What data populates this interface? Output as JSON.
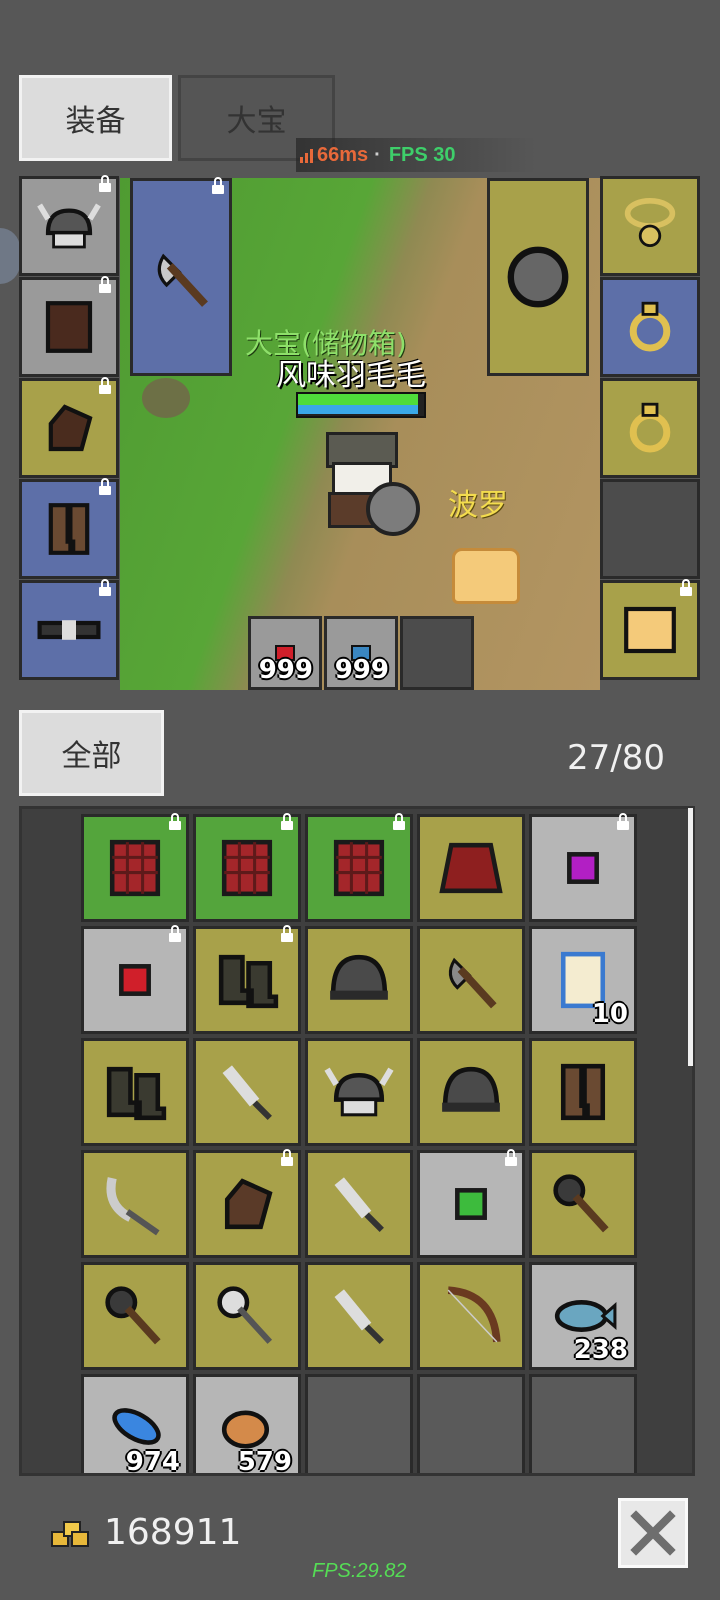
{
  "tabs": {
    "equipment": "装备",
    "character": "大宝"
  },
  "net": {
    "ping": "66ms",
    "separator": "·",
    "fps": "FPS 30"
  },
  "scene": {
    "storage_label": "大宝(储物箱)",
    "player_name": "风味羽毛毛",
    "pet_name": "波罗",
    "hp_fraction": 0.95,
    "mp_fraction": 0.95
  },
  "equip_left": [
    {
      "icon": "horned-helmet-icon",
      "color": "gray",
      "locked": true
    },
    {
      "icon": "leather-armor-icon",
      "color": "gray",
      "locked": true
    },
    {
      "icon": "glove-icon",
      "color": "yellow",
      "locked": true
    },
    {
      "icon": "boots-icon",
      "color": "blue",
      "locked": true
    },
    {
      "icon": "belt-icon",
      "color": "blue",
      "locked": true
    }
  ],
  "weapon_slot": {
    "icon": "axe-icon",
    "color": "blue",
    "locked": true
  },
  "shield_slot": {
    "icon": "round-shield-icon",
    "color": "yellow"
  },
  "equip_right": [
    {
      "icon": "necklace-icon",
      "color": "yellow",
      "locked": false
    },
    {
      "icon": "ring-icon",
      "color": "blue",
      "locked": false
    },
    {
      "icon": "ring-icon",
      "color": "yellow",
      "locked": false
    },
    {
      "icon": "empty-slot-icon",
      "color": "darkgray",
      "locked": false
    },
    {
      "icon": "pet-portrait-icon",
      "color": "yellow",
      "locked": true
    }
  ],
  "quickbar": [
    {
      "icon": "red-potion-icon",
      "count": "999"
    },
    {
      "icon": "blue-potion-icon",
      "count": "999"
    },
    {
      "icon": "empty-slot-icon",
      "count": ""
    }
  ],
  "filter": {
    "label": "全部"
  },
  "capacity": "27/80",
  "inventory": [
    {
      "icon": "red-armor-icon",
      "color": "green",
      "locked": true,
      "count": ""
    },
    {
      "icon": "red-armor-icon",
      "color": "green",
      "locked": true,
      "count": ""
    },
    {
      "icon": "red-armor-icon",
      "color": "green",
      "locked": true,
      "count": ""
    },
    {
      "icon": "red-robe-icon",
      "color": "yellow",
      "locked": false,
      "count": ""
    },
    {
      "icon": "purple-gem-icon",
      "color": "light",
      "locked": true,
      "count": ""
    },
    {
      "icon": "red-gem-icon",
      "color": "light",
      "locked": true,
      "count": ""
    },
    {
      "icon": "dark-boots-icon",
      "color": "yellow",
      "locked": true,
      "count": ""
    },
    {
      "icon": "iron-helmet-icon",
      "color": "yellow",
      "locked": false,
      "count": ""
    },
    {
      "icon": "hand-axe-icon",
      "color": "yellow",
      "locked": false,
      "count": ""
    },
    {
      "icon": "scroll-icon",
      "color": "light",
      "locked": false,
      "count": "10"
    },
    {
      "icon": "dark-boots-icon",
      "color": "yellow",
      "locked": false,
      "count": ""
    },
    {
      "icon": "dagger-icon",
      "color": "yellow",
      "locked": false,
      "count": ""
    },
    {
      "icon": "horned-helmet-icon",
      "color": "yellow",
      "locked": false,
      "count": ""
    },
    {
      "icon": "iron-helmet-icon",
      "color": "yellow",
      "locked": false,
      "count": ""
    },
    {
      "icon": "leather-boots-icon",
      "color": "yellow",
      "locked": false,
      "count": ""
    },
    {
      "icon": "scythe-icon",
      "color": "yellow",
      "locked": false,
      "count": ""
    },
    {
      "icon": "leather-glove-icon",
      "color": "yellow",
      "locked": true,
      "count": ""
    },
    {
      "icon": "dagger-icon",
      "color": "yellow",
      "locked": false,
      "count": ""
    },
    {
      "icon": "green-gem-icon",
      "color": "light",
      "locked": true,
      "count": ""
    },
    {
      "icon": "mace-icon",
      "color": "yellow",
      "locked": false,
      "count": ""
    },
    {
      "icon": "mace-icon",
      "color": "yellow",
      "locked": false,
      "count": ""
    },
    {
      "icon": "spiked-mace-icon",
      "color": "yellow",
      "locked": false,
      "count": ""
    },
    {
      "icon": "dagger-icon",
      "color": "yellow",
      "locked": false,
      "count": ""
    },
    {
      "icon": "bow-icon",
      "color": "yellow",
      "locked": false,
      "count": ""
    },
    {
      "icon": "fish-icon",
      "color": "light",
      "locked": false,
      "count": "238"
    },
    {
      "icon": "blue-feather-icon",
      "color": "light",
      "locked": false,
      "count": "974"
    },
    {
      "icon": "bread-icon",
      "color": "light",
      "locked": false,
      "count": "579"
    },
    {
      "icon": "empty-slot-icon",
      "color": "dark",
      "locked": false,
      "count": ""
    },
    {
      "icon": "empty-slot-icon",
      "color": "dark",
      "locked": false,
      "count": ""
    },
    {
      "icon": "empty-slot-icon",
      "color": "dark",
      "locked": false,
      "count": ""
    }
  ],
  "gold": "168911",
  "fps_footer": "FPS:29.82",
  "colors": {
    "gray": "#9a9a9a",
    "yellow": "#a8a14a",
    "blue": "#5d6fa8",
    "green": "#54a53c",
    "light": "#b6b6b6",
    "dark": "#5a5a5a",
    "darkgray": "#4c4c4c"
  }
}
